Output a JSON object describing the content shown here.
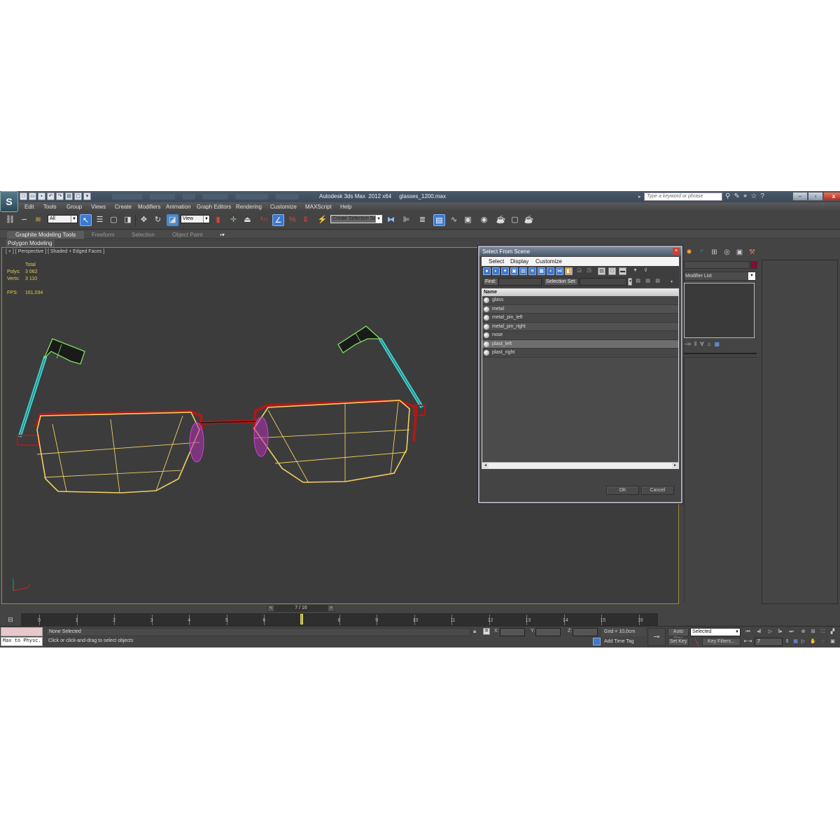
{
  "titlebar": {
    "title": "Autodesk 3ds Max  2012 x64     glasses_1200.max",
    "search_placeholder": "Type a keyword or phrase",
    "app_logo": "3ds-max-logo",
    "quick_access": [
      "new-icon",
      "open-icon",
      "save-icon",
      "undo-icon",
      "redo-icon",
      "project-icon",
      "window-icon"
    ],
    "help_icons": [
      "binoculars-icon",
      "wrench-icon",
      "satellite-icon",
      "star-icon",
      "help-icon"
    ],
    "window_buttons": {
      "minimize": "–",
      "restore": "▫",
      "close": "x"
    }
  },
  "menubar": {
    "items": [
      "Edit",
      "Tools",
      "Group",
      "Views",
      "Create",
      "Modifiers",
      "Animation",
      "Graph Editors",
      "Rendering",
      "Customize",
      "MAXScript",
      "Help"
    ]
  },
  "toolbar": {
    "selection_filter": "All",
    "reference_coord": "View",
    "named_selection": "Create Selection Se"
  },
  "ribbon": {
    "tabs": [
      "Graphite Modeling Tools",
      "Freeform",
      "Selection",
      "Object Paint"
    ],
    "active_tab": "Graphite Modeling Tools",
    "panel": "Polygon Modeling"
  },
  "viewport": {
    "label": "[ + ] [ Perspective ] [ Shaded + Edged Faces ]",
    "stats": {
      "header": "Total",
      "polys_label": "Polys:",
      "polys": "3 062",
      "verts_label": "Verts:",
      "verts": "3 110",
      "fps_label": "FPS:",
      "fps": "161,034"
    },
    "axis": {
      "x": "x",
      "z": "z"
    },
    "colors": {
      "lens": "#f0d060",
      "frame": "#b01818",
      "temple": "#40d0d0",
      "tip": "#80e060",
      "nose_pad": "#d040d0",
      "border": "#a08a30"
    }
  },
  "dialog": {
    "title": "Select From Scene",
    "menu": [
      "Select",
      "Display",
      "Customize"
    ],
    "find_label": "Find:",
    "find_value": "",
    "selection_set_label": "Selection Set:",
    "selection_set_value": "",
    "column_header": "Name",
    "objects": [
      {
        "name": "glass",
        "highlighted": false
      },
      {
        "name": "metal",
        "highlighted": false
      },
      {
        "name": "metal_pin_left",
        "highlighted": false
      },
      {
        "name": "metal_pin_right",
        "highlighted": false
      },
      {
        "name": "nose",
        "highlighted": false
      },
      {
        "name": "plast_left",
        "highlighted": true
      },
      {
        "name": "plast_right",
        "highlighted": false
      }
    ],
    "ok_label": "OK",
    "cancel_label": "Cancel"
  },
  "command_panel": {
    "tabs": [
      "create-icon",
      "modify-icon",
      "hierarchy-icon",
      "motion-icon",
      "display-icon",
      "utilities-icon"
    ],
    "object_name": "",
    "object_color": "#8a0a3a",
    "modifier_list": "Modifier List"
  },
  "timeline": {
    "frame_display": "7 / 16",
    "current_frame": 7,
    "ticks": [
      0,
      1,
      2,
      3,
      4,
      5,
      6,
      7,
      8,
      9,
      10,
      11,
      12,
      13,
      14,
      15,
      16
    ],
    "start": 0,
    "end": 16
  },
  "status": {
    "maxscript_label": "Max to Physc.",
    "selection": "None Selected",
    "prompt": "Click or click-and-drag to select objects",
    "x_label": "X:",
    "y_label": "Y:",
    "z_label": "Z:",
    "x": "",
    "y": "",
    "z": "",
    "grid": "Grid = 10,0cm",
    "add_time_tag": "Add Time Tag",
    "auto_key": "Auto Key",
    "set_key": "Set Key",
    "key_mode": "Selected",
    "key_filters": "Key Filters...",
    "frame": "7"
  }
}
